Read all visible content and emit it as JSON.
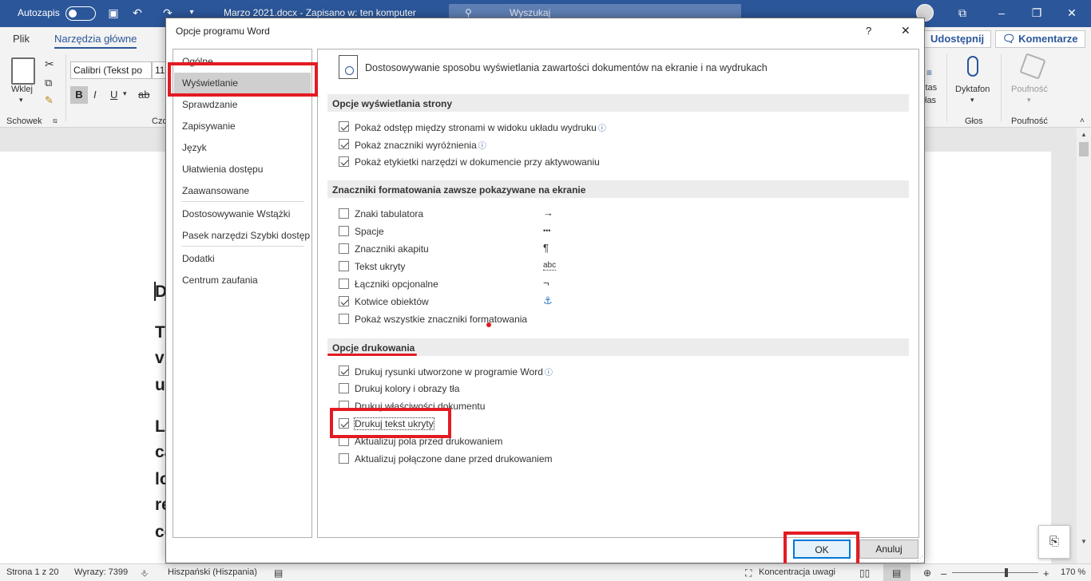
{
  "titlebar": {
    "autosave_label": "Autozapis",
    "doc_title": "Marzo 2021.docx - Zapisano w: ten komputer",
    "search_placeholder": "Wyszukaj"
  },
  "ribbon": {
    "tabs": [
      "Plik",
      "Narzędzia główne",
      "Udostępnij",
      "Komentarze"
    ],
    "paste_label": "Wklej",
    "font_name": "Calibri (Tekst po",
    "font_size": "11",
    "clipboard_group": "Schowek",
    "font_group_partial": "Czc",
    "tools_partial": "itas",
    "tools_partial2": "łas",
    "dictate_label": "Dyktafon",
    "voice_group": "Głos",
    "sensitivity_label": "Poufność",
    "sensitivity_group": "Poufność",
    "format_buttons": [
      "B",
      "I",
      "U",
      "ab"
    ]
  },
  "document": {
    "lines": [
      "D",
      "T",
      "v",
      "u",
      "La",
      "ca",
      "lo",
      "re",
      "co"
    ]
  },
  "status": {
    "page": "Strona 1 z 20",
    "words": "Wyrazy: 7399",
    "language": "Hiszpański (Hiszpania)",
    "focus": "Koncentracja uwagi",
    "zoom": "170 %"
  },
  "dialog": {
    "title": "Opcje programu Word",
    "help": "?",
    "close": "✕",
    "nav": [
      "Ogólne",
      "Wyświetlanie",
      "Sprawdzanie",
      "Zapisywanie",
      "Język",
      "Ułatwienia dostępu",
      "Zaawansowane",
      "Dostosowywanie Wstążki",
      "Pasek narzędzi Szybki dostęp",
      "Dodatki",
      "Centrum zaufania"
    ],
    "header_text": "Dostosowywanie sposobu wyświetlania zawartości dokumentów na ekranie i na wydrukach",
    "section1": "Opcje wyświetlania strony",
    "page_opts": [
      {
        "label": "Pokaż odstęp między stronami w widoku układu wydruku",
        "checked": true,
        "info": true
      },
      {
        "label": "Pokaż znaczniki wyróżnienia",
        "checked": true,
        "info": true
      },
      {
        "label": "Pokaż etykietki narzędzi w dokumencie przy aktywowaniu",
        "checked": true,
        "info": false
      }
    ],
    "section2": "Znaczniki formatowania zawsze pokazywane na ekranie",
    "mark_opts": [
      {
        "label": "Znaki tabulatora",
        "checked": false,
        "symbol": "→"
      },
      {
        "label": "Spacje",
        "checked": false,
        "symbol": "•••"
      },
      {
        "label": "Znaczniki akapitu",
        "checked": false,
        "symbol": "¶"
      },
      {
        "label": "Tekst ukryty",
        "checked": false,
        "symbol": "abc"
      },
      {
        "label": "Łączniki opcjonalne",
        "checked": false,
        "symbol": "¬"
      },
      {
        "label": "Kotwice obiektów",
        "checked": true,
        "symbol": "⚓"
      },
      {
        "label": "Pokaż wszystkie znaczniki formatowania",
        "checked": false,
        "symbol": ""
      }
    ],
    "section3": "Opcje drukowania",
    "print_opts": [
      {
        "label": "Drukuj rysunki utworzone w programie Word",
        "checked": true,
        "info": true
      },
      {
        "label": "Drukuj kolory i obrazy tła",
        "checked": false,
        "info": false
      },
      {
        "label": "Drukuj właściwości dokumentu",
        "checked": false,
        "info": false
      },
      {
        "label": "Drukuj tekst ukryty",
        "checked": true,
        "info": false
      },
      {
        "label": "Aktualizuj pola przed drukowaniem",
        "checked": false,
        "info": false
      },
      {
        "label": "Aktualizuj połączone dane przed drukowaniem",
        "checked": false,
        "info": false
      }
    ],
    "ok": "OK",
    "cancel": "Anuluj"
  },
  "colors": {
    "word_blue": "#2b579a",
    "highlight_red": "#e31b23",
    "focus_blue": "#0078d7"
  }
}
